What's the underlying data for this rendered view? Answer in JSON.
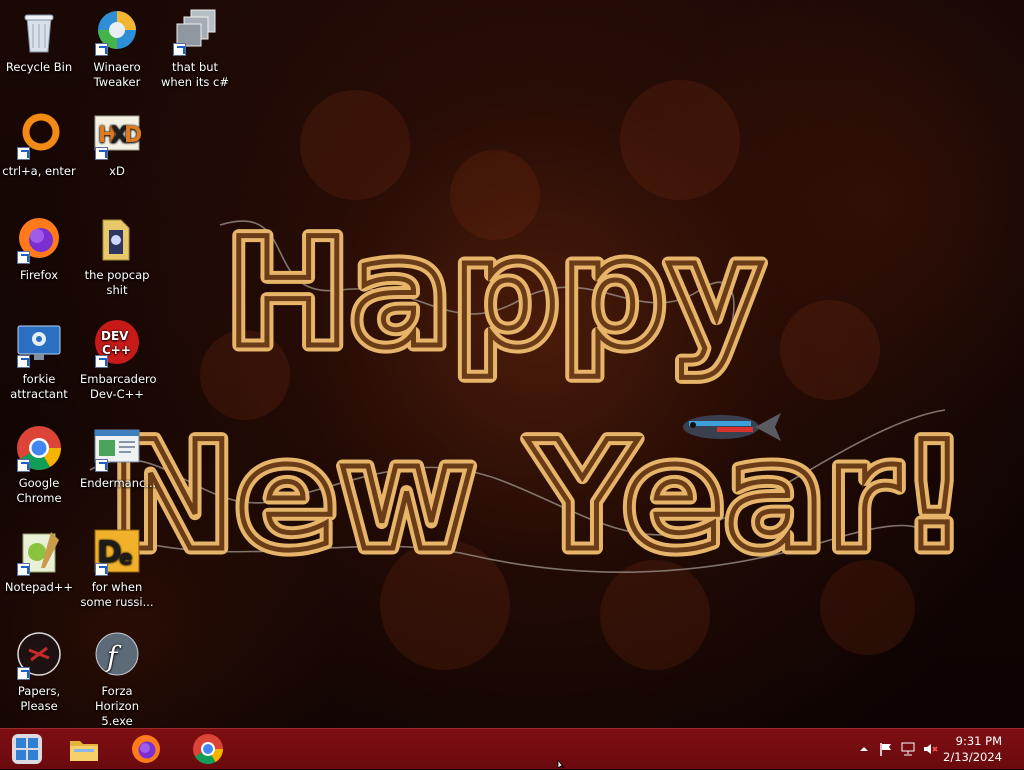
{
  "desktop": {
    "wallpaper": {
      "line1": "Happy",
      "line2": "New Year!"
    },
    "icons": [
      {
        "label": "Recycle Bin",
        "icon": "recycle-bin-icon"
      },
      {
        "label": "Winaero Tweaker",
        "icon": "winaero-tweaker-icon"
      },
      {
        "label": "that but when its c#",
        "icon": "windows-stack-icon"
      },
      {
        "label": "ctrl+a, enter",
        "icon": "orange-ring-icon"
      },
      {
        "label": "xD",
        "icon": "hxd-icon"
      },
      {
        "label": "Firefox",
        "icon": "firefox-icon"
      },
      {
        "label": "the popcap shit",
        "icon": "folder-icon"
      },
      {
        "label": "forkie attractant",
        "icon": "monitor-gear-icon"
      },
      {
        "label": "Embarcadero Dev-C++",
        "icon": "devcpp-icon"
      },
      {
        "label": "Google Chrome",
        "icon": "chrome-icon"
      },
      {
        "label": "Endermanc...",
        "icon": "window-app-icon"
      },
      {
        "label": "Notepad++",
        "icon": "notepadpp-icon"
      },
      {
        "label": "for when some russi...",
        "icon": "de-icon"
      },
      {
        "label": "Papers, Please",
        "icon": "papers-please-icon"
      },
      {
        "label": "Forza Horizon 5.exe",
        "icon": "flash-icon"
      }
    ]
  },
  "taskbar": {
    "start": "start-button",
    "pinned": [
      {
        "name": "file-explorer",
        "icon": "folder-icon"
      },
      {
        "name": "firefox",
        "icon": "firefox-icon"
      },
      {
        "name": "chrome",
        "icon": "chrome-icon"
      }
    ],
    "tray": {
      "time": "9:31 PM",
      "date": "2/13/2024"
    }
  }
}
